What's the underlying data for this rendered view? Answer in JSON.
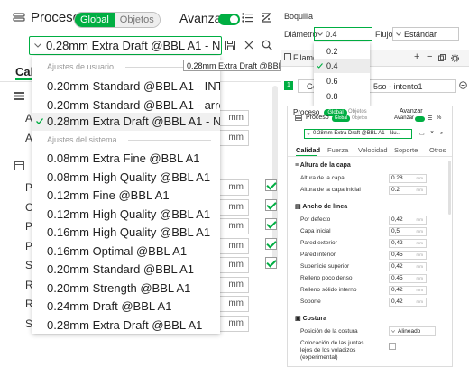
{
  "left": {
    "title": "Proceso",
    "segment": {
      "global": "Global",
      "objetos": "Objetos"
    },
    "advance_label": "Avanzar",
    "preset_value": "0.28mm Extra Draft @BBL A1 - Nu...",
    "tab_partial": "Cal",
    "tooltip": "0.28mm Extra Draft @BBL A1 - N",
    "dropdown": {
      "user_section": "Ajustes de usuario",
      "user_items": [
        "0.20mm Standard @BBL A1 - INTE...",
        "0.20mm Standard @BBL A1 - arreg...",
        "0.28mm Extra Draft @BBL A1 - Nu..."
      ],
      "system_section": "Ajustes del sistema",
      "system_items": [
        "0.08mm Extra Fine @BBL A1",
        "0.08mm High Quality @BBL A1",
        "0.12mm Fine @BBL A1",
        "0.12mm High Quality @BBL A1",
        "0.16mm High Quality @BBL A1",
        "0.16mm Optimal @BBL A1",
        "0.20mm Standard @BBL A1",
        "0.20mm Strength @BBL A1",
        "0.24mm Draft @BBL A1",
        "0.28mm Extra Draft @BBL A1"
      ]
    },
    "bg_unit": "mm",
    "bg_letters": [
      "A",
      "A",
      "P",
      "C",
      "P",
      "P",
      "S",
      "R",
      "R",
      "S"
    ]
  },
  "top_right": {
    "boquilla": "Boquilla",
    "diametro_label": "Diámetro",
    "diametro_value": "0.4",
    "flujo_label": "Flujo",
    "flujo_value": "Estándar",
    "filament_partial": "Filame",
    "row_num": "1",
    "row_text_a": "Ge",
    "row_text_b": "5so - intento1",
    "diam_options": [
      "0.2",
      "0.4",
      "0.6",
      "0.8"
    ]
  },
  "bottom_right": {
    "title": "Proceso",
    "segment": {
      "global": "Global",
      "objetos": "Objetos"
    },
    "advance_label": "Avanzar",
    "preset_value": "0.28mm Extra Draft @BBL A1 - Nu...",
    "tabs": [
      "Calidad",
      "Fuerza",
      "Velocidad",
      "Soporte",
      "Otros"
    ],
    "sections": [
      {
        "title": "Altura de la capa",
        "rows": [
          {
            "label": "Altura de la capa",
            "value": "0.28",
            "unit": "mm"
          },
          {
            "label": "Altura de la capa inicial",
            "value": "0.2",
            "unit": "mm"
          }
        ]
      },
      {
        "title": "Ancho de línea",
        "rows": [
          {
            "label": "Por defecto",
            "value": "0,42",
            "unit": "mm"
          },
          {
            "label": "Capa inicial",
            "value": "0,5",
            "unit": "mm"
          },
          {
            "label": "Pared exterior",
            "value": "0,42",
            "unit": "mm"
          },
          {
            "label": "Pared interior",
            "value": "0,45",
            "unit": "mm"
          },
          {
            "label": "Superficie superior",
            "value": "0,42",
            "unit": "mm"
          },
          {
            "label": "Relleno poco denso",
            "value": "0,45",
            "unit": "mm"
          },
          {
            "label": "Relleno sólido interno",
            "value": "0,42",
            "unit": "mm"
          },
          {
            "label": "Soporte",
            "value": "0,42",
            "unit": "mm"
          }
        ]
      },
      {
        "title": "Costura",
        "rows": [
          {
            "label": "Posición de la costura",
            "value": "Alineado",
            "unit": ""
          }
        ]
      }
    ],
    "overhang_line1": "Colocación de las juntas",
    "overhang_line2": "lejos de los voladizos",
    "overhang_line3": "(experimental)"
  }
}
